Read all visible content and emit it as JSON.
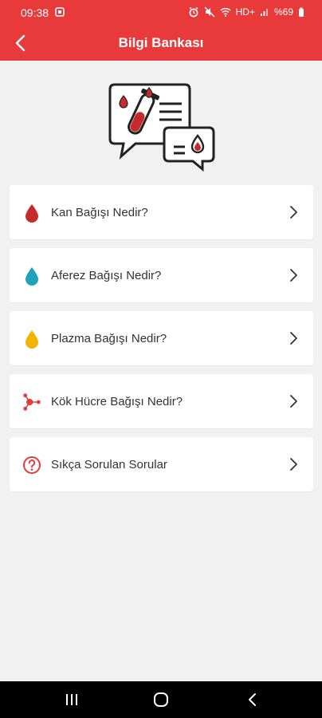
{
  "status_bar": {
    "time": "09:38",
    "network": "HD+",
    "battery": "%69"
  },
  "app_bar": {
    "title": "Bilgi Bankası",
    "back_icon": "chevron-left-icon"
  },
  "hero": {
    "icon": "knowledge-chat-blood-test-illustration"
  },
  "menu": {
    "items": [
      {
        "label": "Kan Bağışı Nedir?",
        "icon": "blood-drop-icon",
        "color": "#c62b2b"
      },
      {
        "label": "Aferez Bağışı Nedir?",
        "icon": "teal-drop-icon",
        "color": "#1fa3b8"
      },
      {
        "label": "Plazma Bağışı Nedir?",
        "icon": "yellow-drop-icon",
        "color": "#f3b400"
      },
      {
        "label": "Kök Hücre Bağışı Nedir?",
        "icon": "stem-cell-icon",
        "color": "#e83a3a"
      },
      {
        "label": "Sıkça Sorulan Sorular",
        "icon": "question-circle-icon",
        "color": "#e83a3a"
      }
    ]
  },
  "colors": {
    "primary": "#e83a3a",
    "background": "#f1f1f1"
  }
}
